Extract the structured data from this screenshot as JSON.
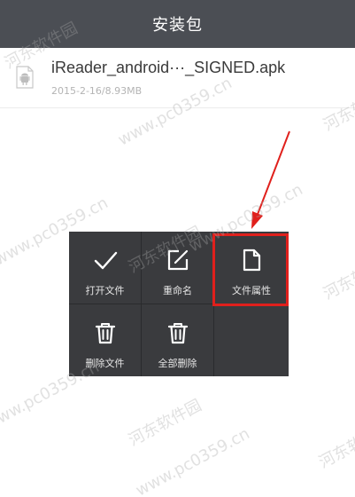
{
  "header": {
    "title": "安装包"
  },
  "file": {
    "name": "iReader_android···_SIGNED.apk",
    "meta": "2015-2-16/8.93MB",
    "icon": "android-apk-icon"
  },
  "menu": {
    "items": [
      {
        "label": "打开文件",
        "icon": "checkmark-icon"
      },
      {
        "label": "重命名",
        "icon": "edit-icon"
      },
      {
        "label": "文件属性",
        "icon": "document-icon"
      },
      {
        "label": "删除文件",
        "icon": "trash-icon"
      },
      {
        "label": "全部删除",
        "icon": "trash-all-icon"
      }
    ]
  },
  "watermark": {
    "line1": "河东软件园",
    "line2": "www.pc0359.cn"
  },
  "colors": {
    "header": "#4b4e54",
    "menu_bg": "#3a3b3e",
    "highlight": "#e0201c"
  }
}
